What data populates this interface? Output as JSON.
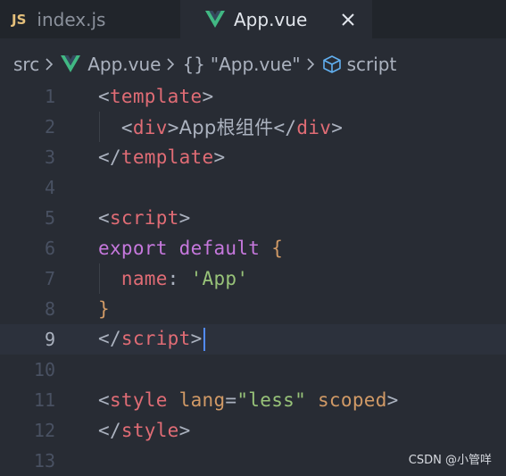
{
  "tabs": [
    {
      "icon": "JS",
      "label": "index.js",
      "active": false
    },
    {
      "icon": "vue-icon",
      "label": "App.vue",
      "active": true
    }
  ],
  "breadcrumb": {
    "folder": "src",
    "file": "App.vue",
    "component": "\"App.vue\"",
    "braces": "{}",
    "section": "script"
  },
  "editor": {
    "current_line": 9,
    "line_numbers": [
      "1",
      "2",
      "3",
      "4",
      "5",
      "6",
      "7",
      "8",
      "9",
      "10",
      "11",
      "12",
      "13"
    ],
    "lines": [
      {
        "t1": "<",
        "t2": "template",
        "t3": ">"
      },
      {
        "t1": "<",
        "t2": "div",
        "t3": ">",
        "t4": "App根组件",
        "t5": "</",
        "t6": "div",
        "t7": ">"
      },
      {
        "t1": "</",
        "t2": "template",
        "t3": ">"
      },
      {},
      {
        "t1": "<",
        "t2": "script",
        "t3": ">"
      },
      {
        "t1": "export",
        "t2": "default",
        "t3": "{"
      },
      {
        "t1": "name",
        "t2": ":",
        "t3": "'App'"
      },
      {
        "t1": "}"
      },
      {
        "t1": "</",
        "t2": "script",
        "t3": ">"
      },
      {},
      {
        "t1": "<",
        "t2": "style",
        "t3": "lang",
        "t4": "=",
        "t5": "\"less\"",
        "t6": "scoped",
        "t7": ">"
      },
      {
        "t1": "</",
        "t2": "style",
        "t3": ">"
      },
      {}
    ]
  },
  "watermark": "CSDN @小管咩",
  "colors": {
    "background": "#282c34",
    "tag": "#e06c75",
    "keyword": "#c678dd",
    "string": "#98c379",
    "attribute": "#d19a66",
    "vue_green": "#41b883",
    "caret": "#528bff"
  }
}
